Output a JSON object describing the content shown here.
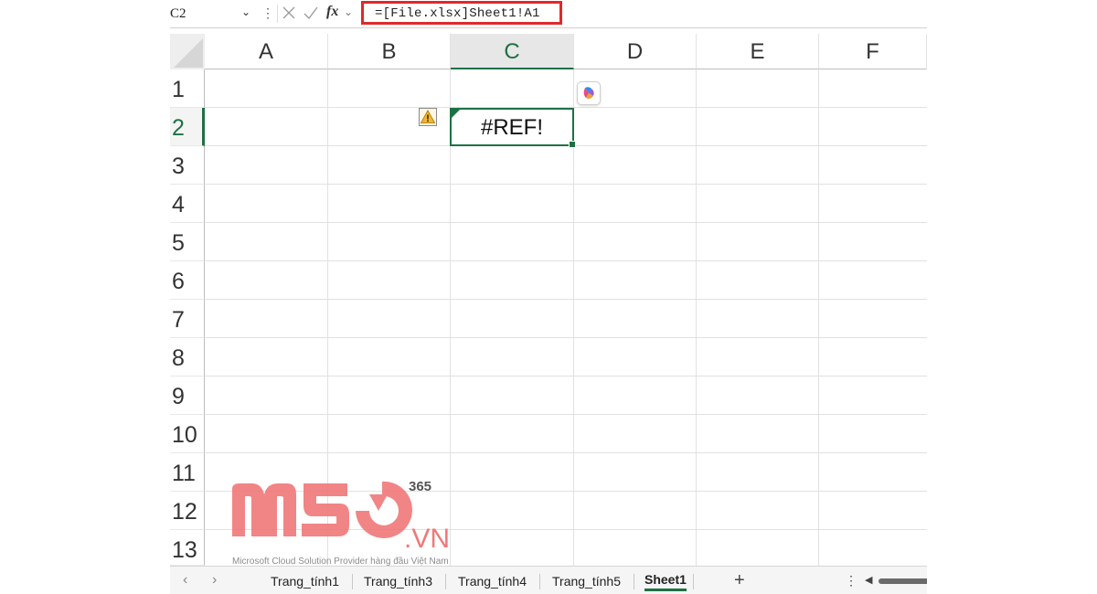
{
  "formula_bar": {
    "name_box": "C2",
    "fx_label": "fx",
    "formula": "=[File.xlsx]Sheet1!A1"
  },
  "columns": [
    "A",
    "B",
    "C",
    "D",
    "E",
    "F"
  ],
  "rows": [
    "1",
    "2",
    "3",
    "4",
    "5",
    "6",
    "7",
    "8",
    "9",
    "10",
    "11",
    "12",
    "13"
  ],
  "selected_cell": {
    "column": "C",
    "row": "2",
    "value": "#REF!"
  },
  "watermark": {
    "brand": "MSO",
    "superscript": "365",
    "suffix": ".VN",
    "tagline": "Microsoft Cloud Solution Provider hàng đầu Việt Nam"
  },
  "sheet_tabs": [
    "Trang_tính1",
    "Trang_tính3",
    "Trang_tính4",
    "Trang_tính5",
    "Sheet1"
  ],
  "active_sheet": "Sheet1",
  "add_sheet_label": "+",
  "icons": {
    "error_warning": "warning-icon",
    "copilot": "copilot-icon",
    "cancel": "close-icon",
    "enter": "check-icon"
  },
  "colors": {
    "accent": "#1e7145",
    "highlight_border": "#e0282e",
    "watermark": "#f07878"
  }
}
